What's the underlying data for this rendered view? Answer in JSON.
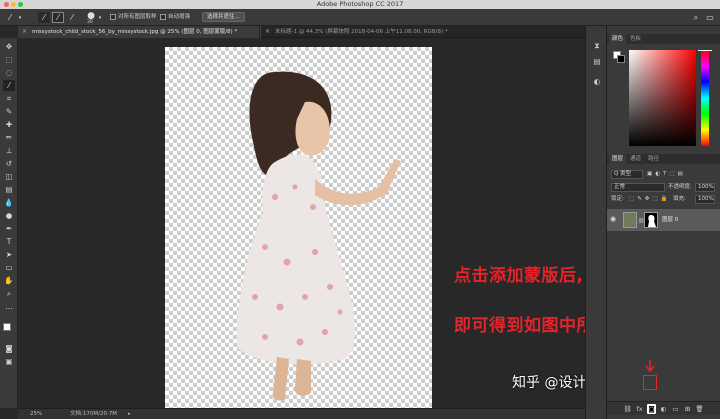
{
  "window": {
    "title": "Adobe Photoshop CC 2017",
    "traffic_colors": [
      "#fc5f57",
      "#fdbc2e",
      "#28c840"
    ]
  },
  "options_bar": {
    "brush_size": "30",
    "sample_all_layers": "对所有图层取样",
    "auto_enhance": "自动增强",
    "select_and_mask": "选择并遮住..."
  },
  "tabs": [
    {
      "label": "missystock_child_stock_56_by_missystock.jpg @ 25% (图层 0, 图层蒙版/8) *",
      "active": true
    },
    {
      "label": "未标题-1 @ 44.3% (屏幕快照 2018-04-06 上午11.08.00, RGB/8) *",
      "active": false
    }
  ],
  "annotation": {
    "line1": "点击添加蒙版后,",
    "line2": "即可得到如图中所示",
    "color": "#e3242b"
  },
  "watermark": "知乎 @设计师后言",
  "status_bar": {
    "zoom": "25%",
    "doc_size": "文档:170M/20.7M"
  },
  "color_panel": {
    "tabs": [
      "颜色",
      "色板"
    ],
    "foreground": "#ffffff",
    "background": "#000000",
    "hue": "#ff0000"
  },
  "layers_panel": {
    "tabs": [
      "图层",
      "通道",
      "路径"
    ],
    "filter_kind": "Q 类型",
    "blend_mode": "正常",
    "opacity_label": "不透明度:",
    "opacity": "100%",
    "lock_label": "锁定:",
    "fill_label": "填充:",
    "fill": "100%",
    "layer_name": "图层 0"
  }
}
